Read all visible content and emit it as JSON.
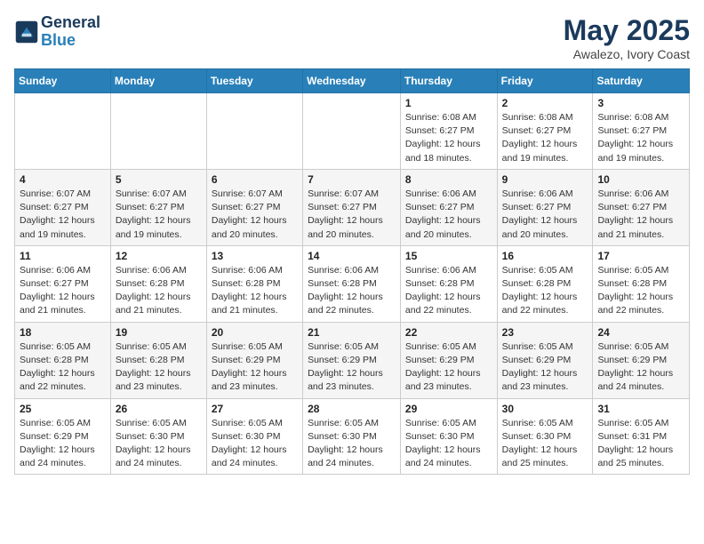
{
  "logo": {
    "line1": "General",
    "line2": "Blue"
  },
  "title": "May 2025",
  "location": "Awalezo, Ivory Coast",
  "days_of_week": [
    "Sunday",
    "Monday",
    "Tuesday",
    "Wednesday",
    "Thursday",
    "Friday",
    "Saturday"
  ],
  "weeks": [
    [
      {
        "day": "",
        "info": ""
      },
      {
        "day": "",
        "info": ""
      },
      {
        "day": "",
        "info": ""
      },
      {
        "day": "",
        "info": ""
      },
      {
        "day": "1",
        "info": "Sunrise: 6:08 AM\nSunset: 6:27 PM\nDaylight: 12 hours and 18 minutes."
      },
      {
        "day": "2",
        "info": "Sunrise: 6:08 AM\nSunset: 6:27 PM\nDaylight: 12 hours and 19 minutes."
      },
      {
        "day": "3",
        "info": "Sunrise: 6:08 AM\nSunset: 6:27 PM\nDaylight: 12 hours and 19 minutes."
      }
    ],
    [
      {
        "day": "4",
        "info": "Sunrise: 6:07 AM\nSunset: 6:27 PM\nDaylight: 12 hours and 19 minutes."
      },
      {
        "day": "5",
        "info": "Sunrise: 6:07 AM\nSunset: 6:27 PM\nDaylight: 12 hours and 19 minutes."
      },
      {
        "day": "6",
        "info": "Sunrise: 6:07 AM\nSunset: 6:27 PM\nDaylight: 12 hours and 20 minutes."
      },
      {
        "day": "7",
        "info": "Sunrise: 6:07 AM\nSunset: 6:27 PM\nDaylight: 12 hours and 20 minutes."
      },
      {
        "day": "8",
        "info": "Sunrise: 6:06 AM\nSunset: 6:27 PM\nDaylight: 12 hours and 20 minutes."
      },
      {
        "day": "9",
        "info": "Sunrise: 6:06 AM\nSunset: 6:27 PM\nDaylight: 12 hours and 20 minutes."
      },
      {
        "day": "10",
        "info": "Sunrise: 6:06 AM\nSunset: 6:27 PM\nDaylight: 12 hours and 21 minutes."
      }
    ],
    [
      {
        "day": "11",
        "info": "Sunrise: 6:06 AM\nSunset: 6:27 PM\nDaylight: 12 hours and 21 minutes."
      },
      {
        "day": "12",
        "info": "Sunrise: 6:06 AM\nSunset: 6:28 PM\nDaylight: 12 hours and 21 minutes."
      },
      {
        "day": "13",
        "info": "Sunrise: 6:06 AM\nSunset: 6:28 PM\nDaylight: 12 hours and 21 minutes."
      },
      {
        "day": "14",
        "info": "Sunrise: 6:06 AM\nSunset: 6:28 PM\nDaylight: 12 hours and 22 minutes."
      },
      {
        "day": "15",
        "info": "Sunrise: 6:06 AM\nSunset: 6:28 PM\nDaylight: 12 hours and 22 minutes."
      },
      {
        "day": "16",
        "info": "Sunrise: 6:05 AM\nSunset: 6:28 PM\nDaylight: 12 hours and 22 minutes."
      },
      {
        "day": "17",
        "info": "Sunrise: 6:05 AM\nSunset: 6:28 PM\nDaylight: 12 hours and 22 minutes."
      }
    ],
    [
      {
        "day": "18",
        "info": "Sunrise: 6:05 AM\nSunset: 6:28 PM\nDaylight: 12 hours and 22 minutes."
      },
      {
        "day": "19",
        "info": "Sunrise: 6:05 AM\nSunset: 6:28 PM\nDaylight: 12 hours and 23 minutes."
      },
      {
        "day": "20",
        "info": "Sunrise: 6:05 AM\nSunset: 6:29 PM\nDaylight: 12 hours and 23 minutes."
      },
      {
        "day": "21",
        "info": "Sunrise: 6:05 AM\nSunset: 6:29 PM\nDaylight: 12 hours and 23 minutes."
      },
      {
        "day": "22",
        "info": "Sunrise: 6:05 AM\nSunset: 6:29 PM\nDaylight: 12 hours and 23 minutes."
      },
      {
        "day": "23",
        "info": "Sunrise: 6:05 AM\nSunset: 6:29 PM\nDaylight: 12 hours and 23 minutes."
      },
      {
        "day": "24",
        "info": "Sunrise: 6:05 AM\nSunset: 6:29 PM\nDaylight: 12 hours and 24 minutes."
      }
    ],
    [
      {
        "day": "25",
        "info": "Sunrise: 6:05 AM\nSunset: 6:29 PM\nDaylight: 12 hours and 24 minutes."
      },
      {
        "day": "26",
        "info": "Sunrise: 6:05 AM\nSunset: 6:30 PM\nDaylight: 12 hours and 24 minutes."
      },
      {
        "day": "27",
        "info": "Sunrise: 6:05 AM\nSunset: 6:30 PM\nDaylight: 12 hours and 24 minutes."
      },
      {
        "day": "28",
        "info": "Sunrise: 6:05 AM\nSunset: 6:30 PM\nDaylight: 12 hours and 24 minutes."
      },
      {
        "day": "29",
        "info": "Sunrise: 6:05 AM\nSunset: 6:30 PM\nDaylight: 12 hours and 24 minutes."
      },
      {
        "day": "30",
        "info": "Sunrise: 6:05 AM\nSunset: 6:30 PM\nDaylight: 12 hours and 25 minutes."
      },
      {
        "day": "31",
        "info": "Sunrise: 6:05 AM\nSunset: 6:31 PM\nDaylight: 12 hours and 25 minutes."
      }
    ]
  ]
}
